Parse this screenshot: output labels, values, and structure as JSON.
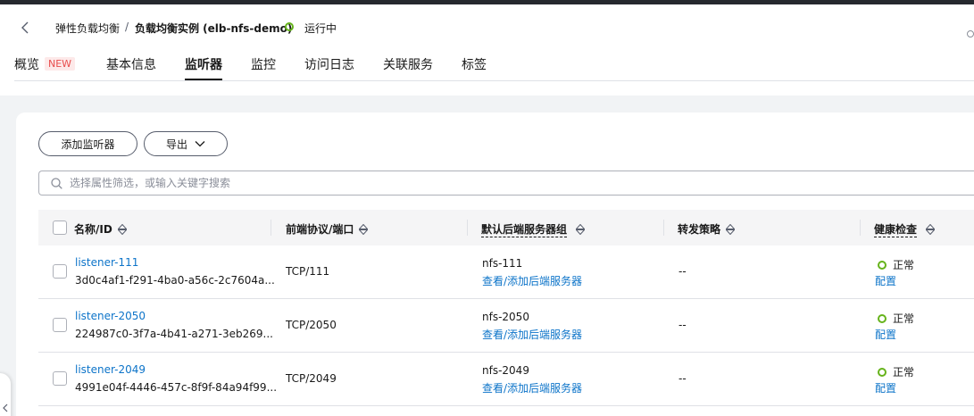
{
  "breadcrumb": {
    "service": "弹性负载均衡",
    "separator": "/",
    "instance": "负载均衡实例 (elb-nfs-demo)",
    "status": "运行中"
  },
  "tabs": [
    {
      "label": "概览",
      "badge": "NEW",
      "active": false
    },
    {
      "label": "基本信息",
      "active": false
    },
    {
      "label": "监听器",
      "active": true
    },
    {
      "label": "监控",
      "active": false
    },
    {
      "label": "访问日志",
      "active": false
    },
    {
      "label": "关联服务",
      "active": false
    },
    {
      "label": "标签",
      "active": false
    }
  ],
  "toolbar": {
    "add_label": "添加监听器",
    "export_label": "导出"
  },
  "search": {
    "placeholder": "选择属性筛选，或输入关键字搜索"
  },
  "table": {
    "columns": {
      "name": "名称/ID",
      "protocol": "前端协议/端口",
      "backend": "默认后端服务器组",
      "policy": "转发策略",
      "health": "健康检查"
    },
    "rows": [
      {
        "name": "listener-111",
        "id": "3d0c4af1-f291-4ba0-a56c-2c7604a...",
        "protocol": "TCP/111",
        "backend_group": "nfs-111",
        "backend_link": "查看/添加后端服务器",
        "policy": "--",
        "health_status": "正常",
        "health_config": "配置"
      },
      {
        "name": "listener-2050",
        "id": "224987c0-3f7a-4b41-a271-3eb269...",
        "protocol": "TCP/2050",
        "backend_group": "nfs-2050",
        "backend_link": "查看/添加后端服务器",
        "policy": "--",
        "health_status": "正常",
        "health_config": "配置"
      },
      {
        "name": "listener-2049",
        "id": "4991e04f-4446-457c-8f9f-84a94f99...",
        "protocol": "TCP/2049",
        "backend_group": "nfs-2049",
        "backend_link": "查看/添加后端服务器",
        "policy": "--",
        "health_status": "正常",
        "health_config": "配置"
      }
    ]
  },
  "colors": {
    "link": "#0d74c9",
    "status_green": "#66b31b",
    "badge_red": "#e84d4d"
  }
}
